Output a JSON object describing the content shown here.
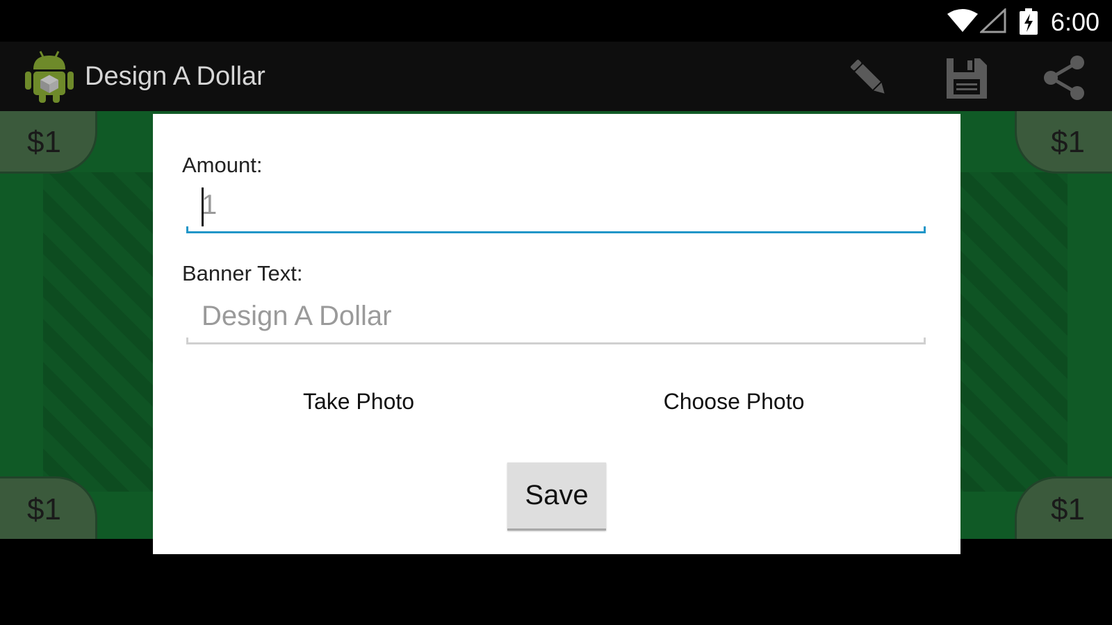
{
  "status_bar": {
    "time": "6:00",
    "icons": [
      "wifi-icon",
      "cell-signal-icon",
      "battery-charging-icon"
    ]
  },
  "action_bar": {
    "title": "Design A Dollar",
    "app_icon": "android-robot-icon",
    "actions": [
      {
        "icon": "pencil-icon",
        "label": "Edit"
      },
      {
        "icon": "floppy-disk-icon",
        "label": "Save"
      },
      {
        "icon": "share-icon",
        "label": "Share"
      }
    ]
  },
  "bill": {
    "corner_labels": {
      "top_left": "$1",
      "top_right": "$1",
      "bottom_left": "$1",
      "bottom_right": "$1"
    }
  },
  "dialog": {
    "amount": {
      "label": "Amount:",
      "value": "",
      "placeholder": "1"
    },
    "banner_text": {
      "label": "Banner Text:",
      "value": "",
      "placeholder": "Design A Dollar"
    },
    "take_photo_label": "Take Photo",
    "choose_photo_label": "Choose Photo",
    "save_label": "Save"
  },
  "colors": {
    "bill_green": "#105a26",
    "corner_green": "#3b5a3c",
    "focus_underline": "#2196c8",
    "action_bar": "#0e0e0e"
  }
}
